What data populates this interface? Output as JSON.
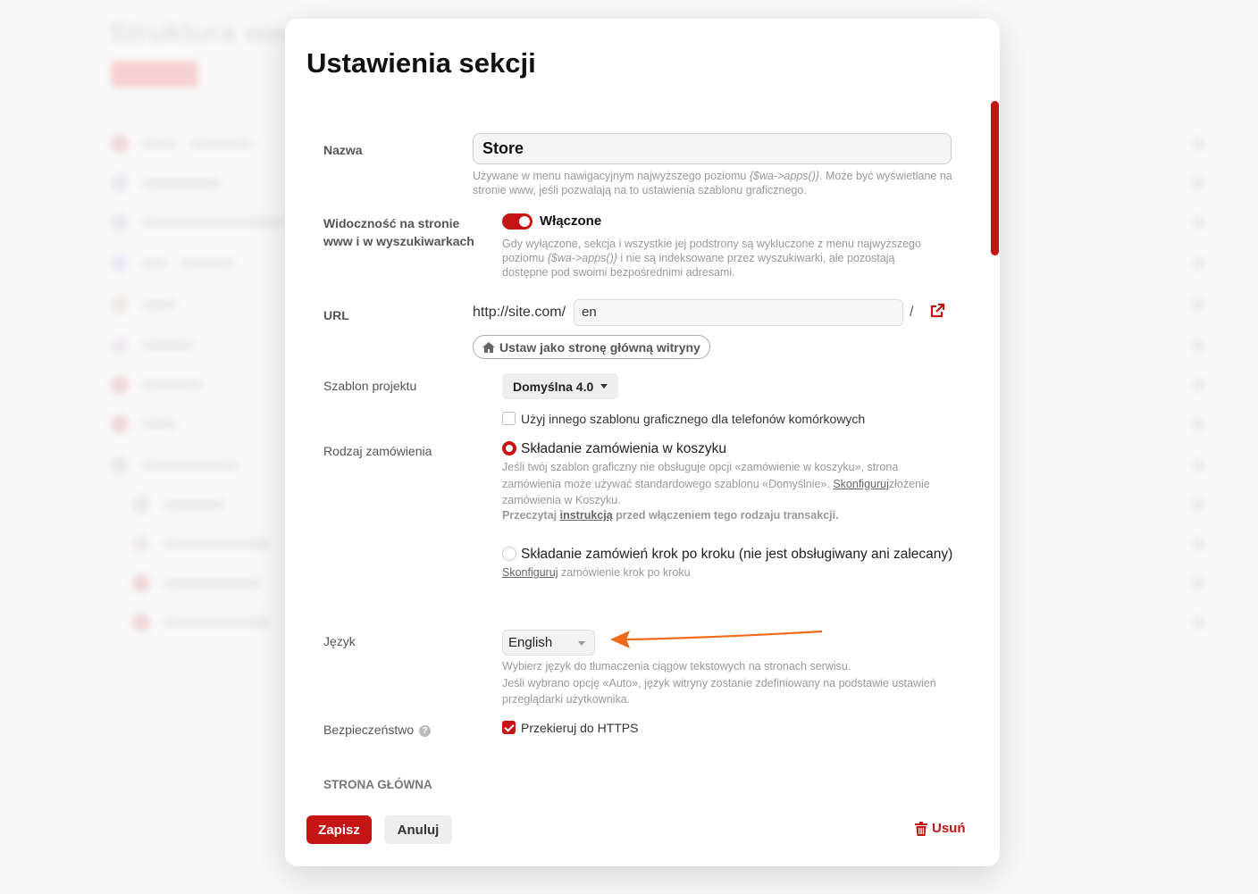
{
  "background": {
    "title": "Struktura ww"
  },
  "dialog": {
    "title": "Ustawienia sekcji",
    "name": {
      "label": "Nazwa",
      "value": "Store",
      "hint_prefix": "Używane w menu nawigacyjnym najwyższego poziomu ",
      "hint_code": "{$wa->apps()}",
      "hint_suffix": ". Może być wyświetlane na stronie www, jeśli pozwalają na to ustawienia szablonu graficznego."
    },
    "visibility": {
      "label": "Widoczność na stronie www i w wyszukiwarkach",
      "toggle_state": "on",
      "toggle_label": "Włączone",
      "hint_prefix": "Gdy wyłączone, sekcja i wszystkie jej podstrony są wykluczone z menu najwyższego poziomu ",
      "hint_code": "{$wa->apps()}",
      "hint_suffix": " i nie są indeksowane przez wyszukiwarki, ale pozostają dostępne pod swoimi bezpośrednimi adresami."
    },
    "url": {
      "label": "URL",
      "prefix": "http://site.com/",
      "value": "en",
      "slash": "/",
      "home_button": "Ustaw jako stronę główną witryny"
    },
    "theme": {
      "label": "Szablon projektu",
      "selected": "Domyślna 4.0",
      "mobile_checkbox_label": "Użyj innego szablonu graficznego dla telefonów komórkowych",
      "mobile_checked": false
    },
    "order_type": {
      "label": "Rodzaj zamówienia",
      "option1_label": "Składanie zamówienia w koszyku",
      "option1_selected": true,
      "option1_hint_a": "Jeśli twój szablon graficzny nie obsługuje opcji «zamówienie w koszyku», strona zamówienia może używać standardowego szablonu «Domyślnie». ",
      "option1_hint_link": "Skonfiguruj",
      "option1_hint_b": "złożenie zamówienia w Koszyku.",
      "option1_warn_a": "Przeczytaj ",
      "option1_warn_link": "instrukcją",
      "option1_warn_b": " przed włączeniem tego rodzaju transakcji.",
      "option2_label": "Składanie zamówień krok po kroku (nie jest obsługiwany ani zalecany)",
      "option2_selected": false,
      "option2_hint_link": "Skonfiguruj",
      "option2_hint_b": " zamówienie krok po kroku"
    },
    "language": {
      "label": "Język",
      "selected": "English",
      "hint_line1": "Wybierz język do tłumaczenia ciągów tekstowych na stronach serwisu.",
      "hint_line2": "Jeśli wybrano opcję «Auto», język witryny zostanie zdefiniowany na podstawie ustawień przeglądarki użytkownika."
    },
    "security": {
      "label": "Bezpieczeństwo",
      "help_glyph": "?",
      "https_label": "Przekieruj do HTTPS",
      "https_checked": true
    },
    "section_heading": "STRONA GŁÓWNA",
    "footer": {
      "save": "Zapisz",
      "cancel": "Anuluj",
      "delete": "Usuń"
    }
  },
  "colors": {
    "accent": "#c41414",
    "annotation_arrow": "#f06a1a"
  },
  "icons": [
    "external-link-icon",
    "home-icon",
    "trash-icon",
    "help-icon",
    "caret-down-icon",
    "annotation-arrow"
  ]
}
